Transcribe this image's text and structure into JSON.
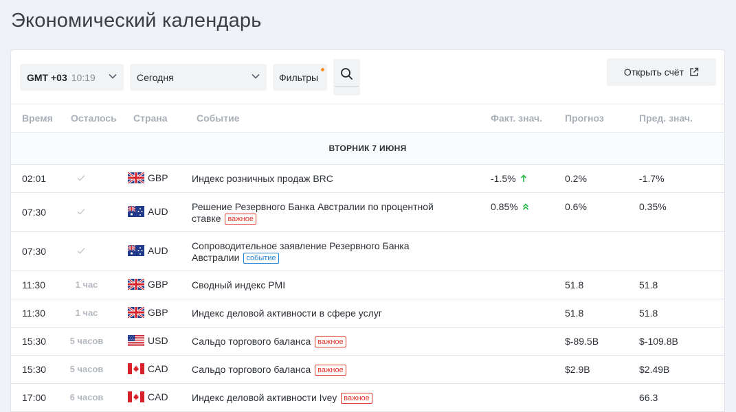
{
  "page": {
    "title": "Экономический календарь"
  },
  "toolbar": {
    "timezone": "GMT +03",
    "time": "10:19",
    "date_filter": "Сегодня",
    "filters_label": "Фильтры",
    "open_account_label": "Открыть счёт"
  },
  "table": {
    "headers": {
      "time": "Время",
      "remaining": "Осталось",
      "country": "Страна",
      "event": "Событие",
      "actual": "Факт. знач.",
      "forecast": "Прогноз",
      "previous": "Пред. знач."
    },
    "day_label": "ВТОРНИК 7 ИЮНЯ",
    "rows": [
      {
        "time": "02:01",
        "remaining": "",
        "country": "GBP",
        "flag": "gb",
        "event": "Индекс розничных продаж BRC",
        "badge": "",
        "actual": "-1.5%",
        "actual_icon": "arrow-up-icon",
        "forecast": "0.2%",
        "previous": "-1.7%"
      },
      {
        "time": "07:30",
        "remaining": "",
        "country": "AUD",
        "flag": "au",
        "event": "Решение Резервного Банка Австралии по процентной ставке",
        "badge": "важное",
        "actual": "0.85%",
        "actual_icon": "double-chevron-up-icon",
        "forecast": "0.6%",
        "previous": "0.35%"
      },
      {
        "time": "07:30",
        "remaining": "",
        "country": "AUD",
        "flag": "au",
        "event": "Сопроводительное заявление Резервного Банка Австралии",
        "badge": "событие",
        "actual": "",
        "actual_icon": "",
        "forecast": "",
        "previous": ""
      },
      {
        "time": "11:30",
        "remaining": "1 час",
        "country": "GBP",
        "flag": "gb",
        "event": "Сводный индекс PMI",
        "badge": "",
        "actual": "",
        "actual_icon": "",
        "forecast": "51.8",
        "previous": "51.8"
      },
      {
        "time": "11:30",
        "remaining": "1 час",
        "country": "GBP",
        "flag": "gb",
        "event": "Индекс деловой активности в сфере услуг",
        "badge": "",
        "actual": "",
        "actual_icon": "",
        "forecast": "51.8",
        "previous": "51.8"
      },
      {
        "time": "15:30",
        "remaining": "5 часов",
        "country": "USD",
        "flag": "us",
        "event": "Сальдо торгового баланса",
        "badge": "важное",
        "actual": "",
        "actual_icon": "",
        "forecast": "$-89.5B",
        "previous": "$-109.8B"
      },
      {
        "time": "15:30",
        "remaining": "5 часов",
        "country": "CAD",
        "flag": "ca",
        "event": "Сальдо торгового баланса",
        "badge": "важное",
        "actual": "",
        "actual_icon": "",
        "forecast": "$2.9B",
        "previous": "$2.49B"
      },
      {
        "time": "17:00",
        "remaining": "6 часов",
        "country": "CAD",
        "flag": "ca",
        "event": "Индекс деловой активности Ivey",
        "badge": "важное",
        "actual": "",
        "actual_icon": "",
        "forecast": "",
        "previous": "66.3"
      }
    ]
  },
  "colors": {
    "accent_up": "#2db84d",
    "badge_important": "#e0362c",
    "badge_event": "#1e7fd4",
    "filters_dot": "#ff8a1f"
  }
}
